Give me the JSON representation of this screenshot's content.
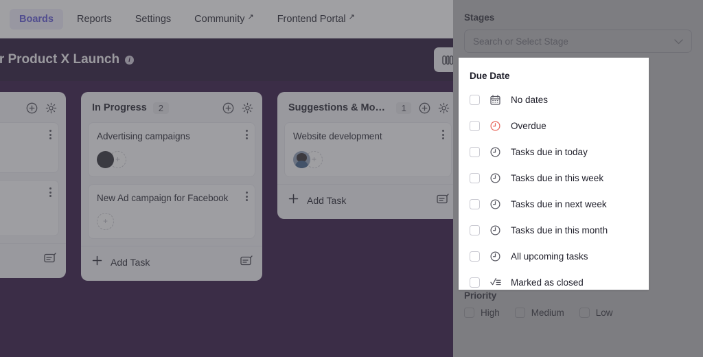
{
  "topnav": {
    "items": [
      {
        "label": "Boards",
        "active": true,
        "external": false
      },
      {
        "label": "Reports",
        "active": false,
        "external": false
      },
      {
        "label": "Settings",
        "active": false,
        "external": false
      },
      {
        "label": "Community",
        "active": false,
        "external": true
      },
      {
        "label": "Frontend Portal",
        "active": false,
        "external": true
      }
    ],
    "external_glyph": "↗"
  },
  "header": {
    "title": "n for Product X Launch",
    "info_glyph": "i",
    "view_toggle_name": "board-view-toggle"
  },
  "board": {
    "columns": [
      {
        "name": "clipped-left-column",
        "title": "",
        "count": "",
        "clipped": true,
        "cards": [
          {
            "title": "",
            "label_color": "",
            "avatar": "none"
          },
          {
            "title": "",
            "label_color": "",
            "avatar": "none"
          }
        ],
        "add_task_label": ""
      },
      {
        "name": "in-progress",
        "title": "In Progress",
        "count": "2",
        "clipped": false,
        "cards": [
          {
            "title": "Advertising campaigns",
            "label_color": "",
            "avatar": "dark"
          },
          {
            "title": "New Ad campaign for Facebook",
            "label_color": "#1e9e57",
            "avatar": "placeholder"
          }
        ],
        "add_task_label": "Add Task"
      },
      {
        "name": "suggestions-modifications",
        "title": "Suggestions & Modific...",
        "count": "1",
        "clipped": false,
        "cards": [
          {
            "title": "Website development",
            "label_color": "#6b6bd6",
            "avatar": "photo"
          }
        ],
        "add_task_label": "Add Task"
      }
    ]
  },
  "sidebar": {
    "stages": {
      "label": "Stages",
      "placeholder": "Search or Select Stage",
      "value": ""
    },
    "due_date": {
      "label": "Due Date",
      "options": [
        {
          "label": "No dates",
          "icon": "calendar-icon",
          "checked": false,
          "color": "#55555f"
        },
        {
          "label": "Overdue",
          "icon": "clock-icon",
          "checked": false,
          "color": "#e8665c"
        },
        {
          "label": "Tasks due in today",
          "icon": "clock-icon",
          "checked": false,
          "color": "#55555f"
        },
        {
          "label": "Tasks due in this week",
          "icon": "clock-icon",
          "checked": false,
          "color": "#55555f"
        },
        {
          "label": "Tasks due in next week",
          "icon": "clock-icon",
          "checked": false,
          "color": "#55555f"
        },
        {
          "label": "Tasks due in this month",
          "icon": "clock-icon",
          "checked": false,
          "color": "#55555f"
        },
        {
          "label": "All upcoming tasks",
          "icon": "clock-icon",
          "checked": false,
          "color": "#55555f"
        },
        {
          "label": "Marked as closed",
          "icon": "checklist-icon",
          "checked": false,
          "color": "#55555f"
        }
      ]
    },
    "priority": {
      "label": "Priority",
      "options": [
        {
          "label": "High",
          "checked": false
        },
        {
          "label": "Medium",
          "checked": false
        },
        {
          "label": "Low",
          "checked": false
        }
      ]
    }
  },
  "colors": {
    "accent": "#5b53d6",
    "header_band": "#231033",
    "board_bg": "#2c0f3f",
    "overdue": "#e8665c",
    "label_green": "#1e9e57",
    "label_purple": "#6b6bd6"
  }
}
